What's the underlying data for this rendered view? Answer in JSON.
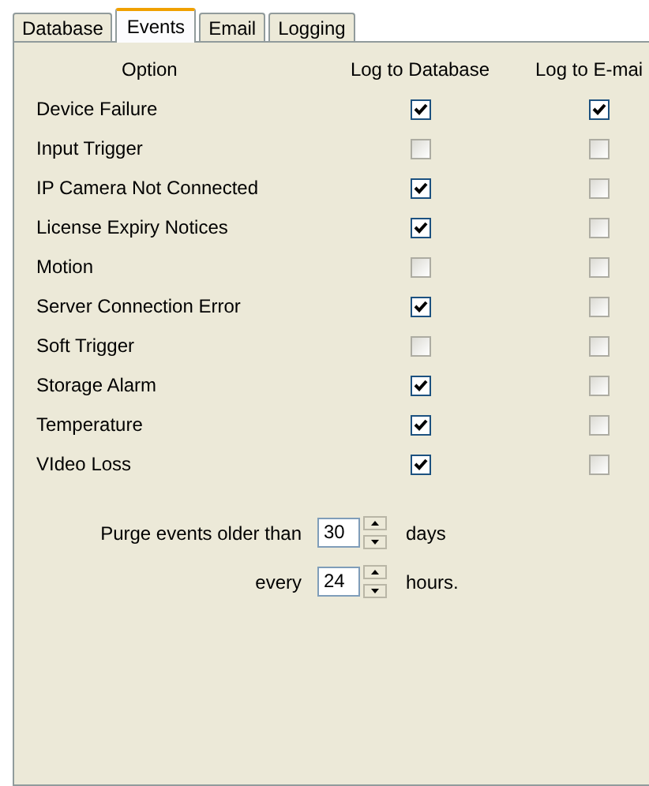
{
  "tabs": [
    {
      "label": "Database",
      "selected": false
    },
    {
      "label": "Events",
      "selected": true
    },
    {
      "label": "Email",
      "selected": false
    },
    {
      "label": "Logging",
      "selected": false
    }
  ],
  "table": {
    "columns": [
      "Option",
      "Log to Database",
      "Log to E-mai"
    ],
    "rows": [
      {
        "option": "Device Failure",
        "log_to_database": true,
        "log_to_email": true
      },
      {
        "option": "Input Trigger",
        "log_to_database": false,
        "log_to_email": false
      },
      {
        "option": "IP Camera Not Connected",
        "log_to_database": true,
        "log_to_email": false
      },
      {
        "option": "License Expiry Notices",
        "log_to_database": true,
        "log_to_email": false
      },
      {
        "option": "Motion",
        "log_to_database": false,
        "log_to_email": false
      },
      {
        "option": "Server Connection Error",
        "log_to_database": true,
        "log_to_email": false
      },
      {
        "option": "Soft Trigger",
        "log_to_database": false,
        "log_to_email": false
      },
      {
        "option": "Storage Alarm",
        "log_to_database": true,
        "log_to_email": false
      },
      {
        "option": "Temperature",
        "log_to_database": true,
        "log_to_email": false
      },
      {
        "option": "VIdeo Loss",
        "log_to_database": true,
        "log_to_email": false
      }
    ]
  },
  "purge": {
    "label": "Purge events older than",
    "value": "30",
    "unit": "days"
  },
  "every": {
    "label": "every",
    "value": "24",
    "unit": "hours."
  }
}
